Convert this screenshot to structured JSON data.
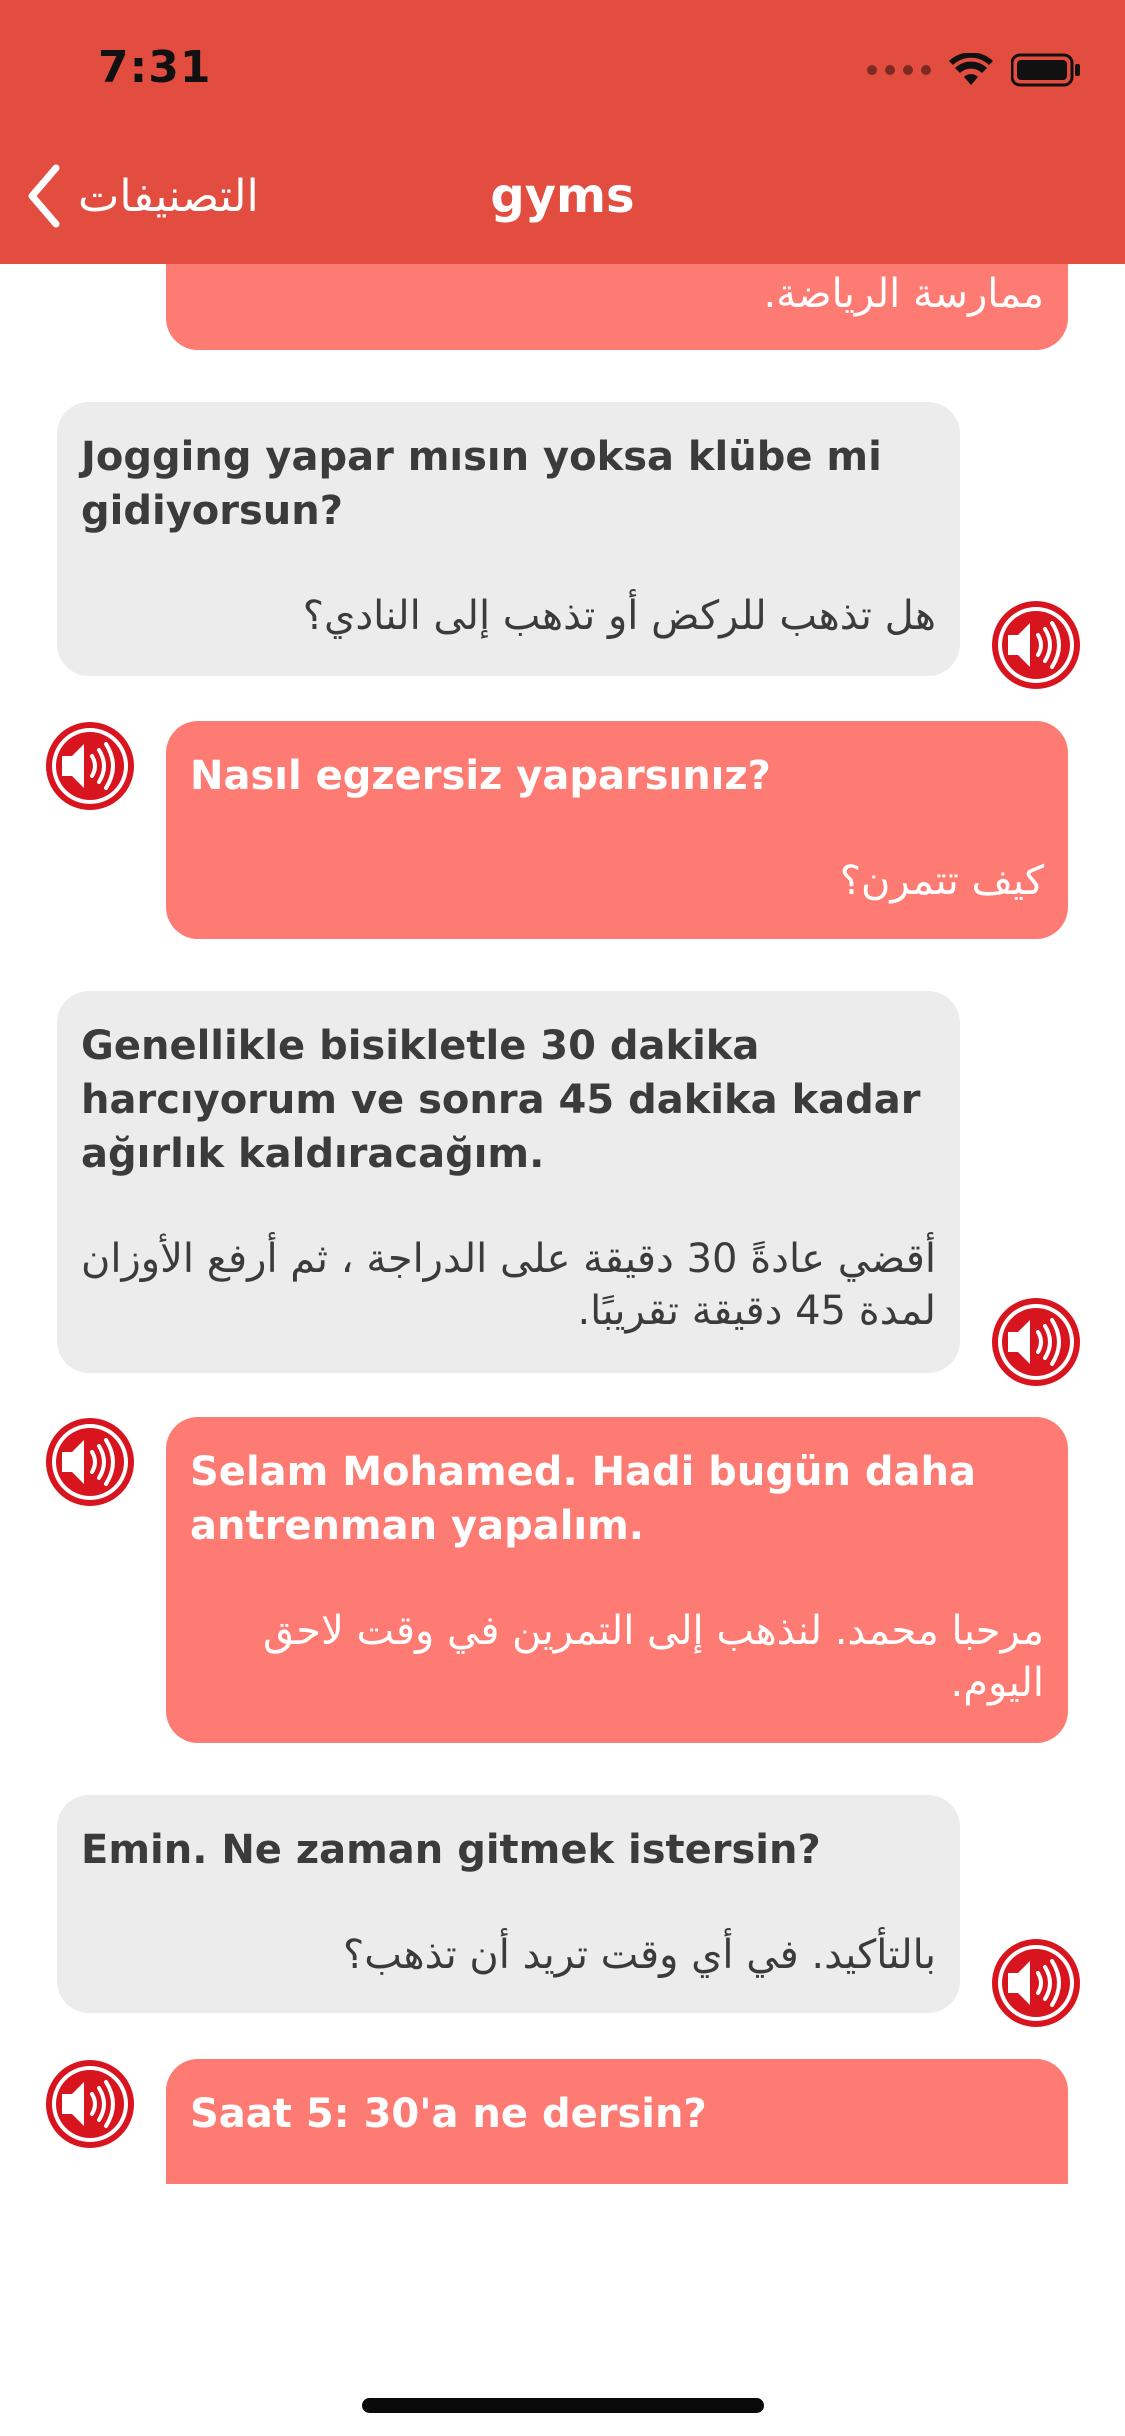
{
  "status_bar": {
    "time": "7:31"
  },
  "nav": {
    "back_label": "التصنيفات",
    "title": "gyms"
  },
  "messages": [
    {
      "side": "red",
      "tr": "",
      "ar": "ممارسة الرياضة."
    },
    {
      "side": "gray",
      "tr": "Jogging yapar mısın yoksa klübe mi gidiyorsun?",
      "ar": "هل تذهب للركض أو تذهب إلى النادي؟"
    },
    {
      "side": "red",
      "tr": "Nasıl egzersiz yaparsınız?",
      "ar": "كيف تتمرن؟"
    },
    {
      "side": "gray",
      "tr": "Genellikle bisikletle 30 dakika harcıyorum ve sonra 45 dakika kadar ağırlık kaldıracağım.",
      "ar": "أقضي عادةً 30 دقيقة على الدراجة ، ثم أرفع الأوزان لمدة 45 دقيقة تقريبًا."
    },
    {
      "side": "red",
      "tr": "Selam Mohamed. Hadi bugün daha antrenman yapalım.",
      "ar": "مرحبا محمد. لنذهب إلى التمرين في وقت لاحق اليوم."
    },
    {
      "side": "gray",
      "tr": "Emin. Ne zaman gitmek istersin?",
      "ar": "بالتأكيد. في أي وقت تريد أن تذهب؟"
    },
    {
      "side": "red",
      "tr": "Saat 5: 30'a ne dersin?",
      "ar": ""
    }
  ],
  "colors": {
    "header": "#e24d40",
    "bubble_gray": "#ececec",
    "bubble_red": "#fe7b74",
    "speaker_red": "#d8141f"
  },
  "icons": {
    "speaker": "speaker-icon",
    "back": "chevron-left-icon"
  }
}
